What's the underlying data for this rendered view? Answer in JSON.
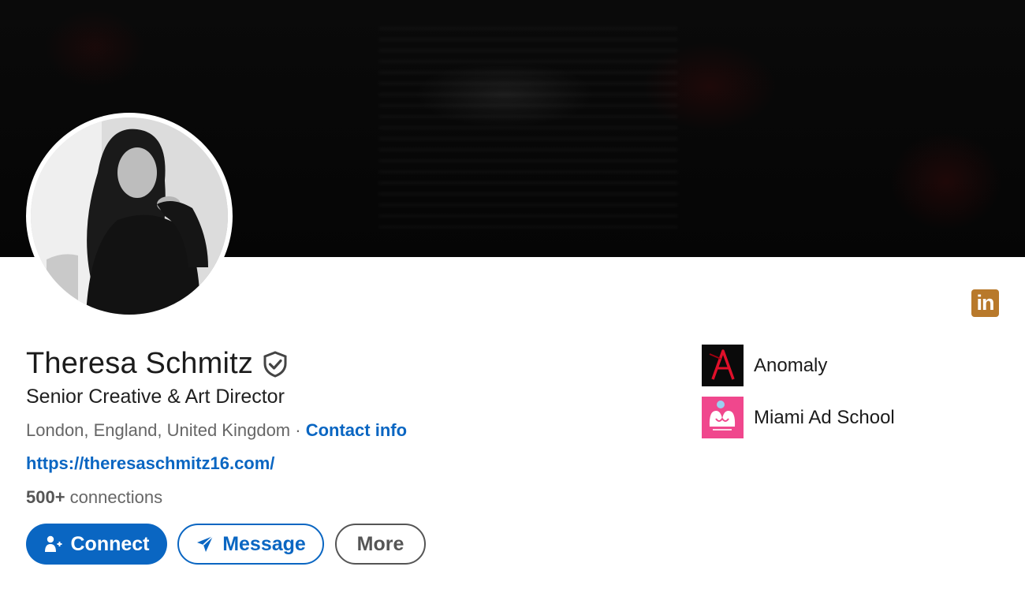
{
  "profile": {
    "name": "Theresa Schmitz",
    "headline": "Senior Creative & Art Director",
    "location": "London, England, United Kingdom",
    "separator": " · ",
    "contact_info_label": "Contact info",
    "website": "https://theresaschmitz16.com/",
    "connections_count": "500+",
    "connections_label": " connections"
  },
  "actions": {
    "connect_label": "Connect",
    "message_label": "Message",
    "more_label": "More"
  },
  "companies": [
    {
      "name": "Anomaly",
      "logo": "anomaly-logo"
    },
    {
      "name": "Miami Ad School",
      "logo": "miami-ad-school-logo"
    }
  ],
  "icons": {
    "verified": "verified-shield-icon",
    "linkedin": "linkedin-icon",
    "connect": "add-person-icon",
    "message": "send-icon"
  },
  "colors": {
    "primary": "#0a66c2",
    "linkedin_badge": "#b8792b",
    "muted_text": "#666666"
  }
}
